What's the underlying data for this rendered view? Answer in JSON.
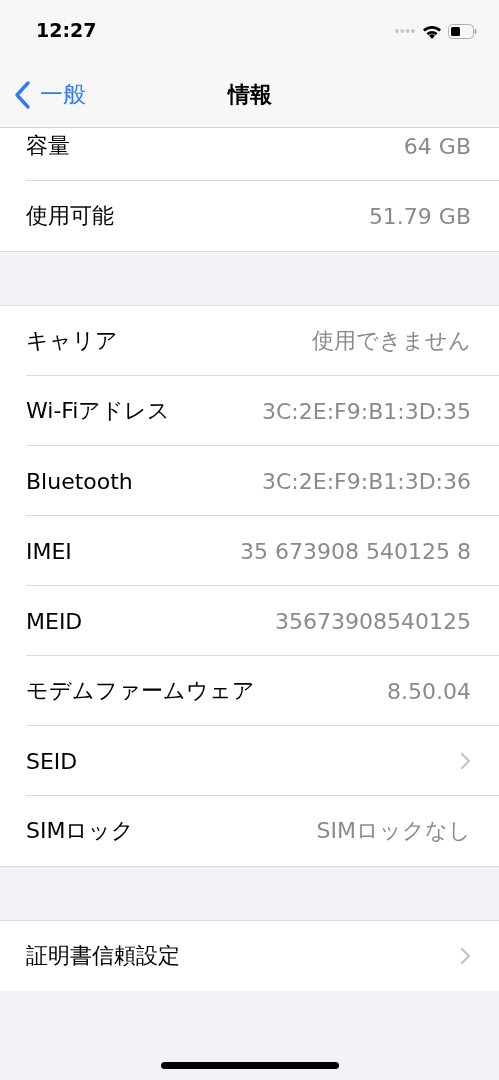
{
  "status_bar": {
    "time": "12:27"
  },
  "nav": {
    "back": "一般",
    "title": "情報"
  },
  "groups": [
    {
      "rows": [
        {
          "kind": "value",
          "label": "容量",
          "value": "64 GB"
        },
        {
          "kind": "value",
          "label": "使用可能",
          "value": "51.79 GB"
        }
      ]
    },
    {
      "rows": [
        {
          "kind": "value",
          "label": "キャリア",
          "value": "使用できません"
        },
        {
          "kind": "value",
          "label": "Wi-Fiアドレス",
          "value": "3C:2E:F9:B1:3D:35"
        },
        {
          "kind": "value",
          "label": "Bluetooth",
          "value": "3C:2E:F9:B1:3D:36"
        },
        {
          "kind": "value",
          "label": "IMEI",
          "value": "35 673908 540125 8"
        },
        {
          "kind": "value",
          "label": "MEID",
          "value": "35673908540125"
        },
        {
          "kind": "value",
          "label": "モデムファームウェア",
          "value": "8.50.04"
        },
        {
          "kind": "link",
          "label": "SEID"
        },
        {
          "kind": "value",
          "label": "SIMロック",
          "value": "SIMロックなし"
        }
      ]
    },
    {
      "rows": [
        {
          "kind": "link",
          "label": "証明書信頼設定"
        }
      ]
    }
  ]
}
